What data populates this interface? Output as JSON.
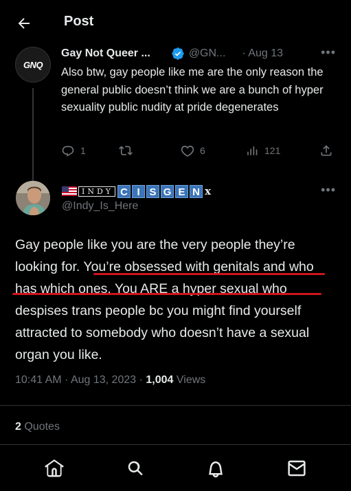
{
  "header": {
    "title": "Post"
  },
  "tweet1": {
    "author_name": "Gay Not Queer ...",
    "handle": "@GN...",
    "date": "· Aug 13",
    "avatar_text": "GNQ",
    "text": "Also btw, gay people like me are the only reason the general public doesn’t think we are a bunch of hyper sexuality public nudity at pride degenerates",
    "replies": "1",
    "reposts": "",
    "likes": "6",
    "views": "121"
  },
  "tweet2": {
    "name_plain": "INDY",
    "name_boxed": [
      "C",
      "I",
      "S",
      "G",
      "E",
      "N"
    ],
    "name_suffix": "x",
    "handle": "@Indy_Is_Here",
    "text": "Gay people like you are the very people they’re looking for. You’re obsessed with genitals and who has which ones. You ARE a hyper sexual who despises trans people bc you might find yourself attracted to somebody who doesn’t have a sexual organ you like.",
    "time": "10:41 AM",
    "date": "Aug 13, 2023",
    "views_count": "1,004",
    "views_label": "Views",
    "quotes_count": "2",
    "quotes_label": "Quotes"
  },
  "icons": {
    "back": "arrow-left-icon",
    "verified": "verified-badge-icon",
    "reply": "reply-icon",
    "repost": "repost-icon",
    "like": "heart-icon",
    "views": "views-icon",
    "share": "share-icon",
    "nav": [
      "home-icon",
      "search-icon",
      "bell-icon",
      "mail-icon"
    ]
  },
  "colors": {
    "background": "#000000",
    "text": "#e7e9ea",
    "muted": "#71767b",
    "verified": "#1d9bf0",
    "underline": "#d0141c"
  }
}
